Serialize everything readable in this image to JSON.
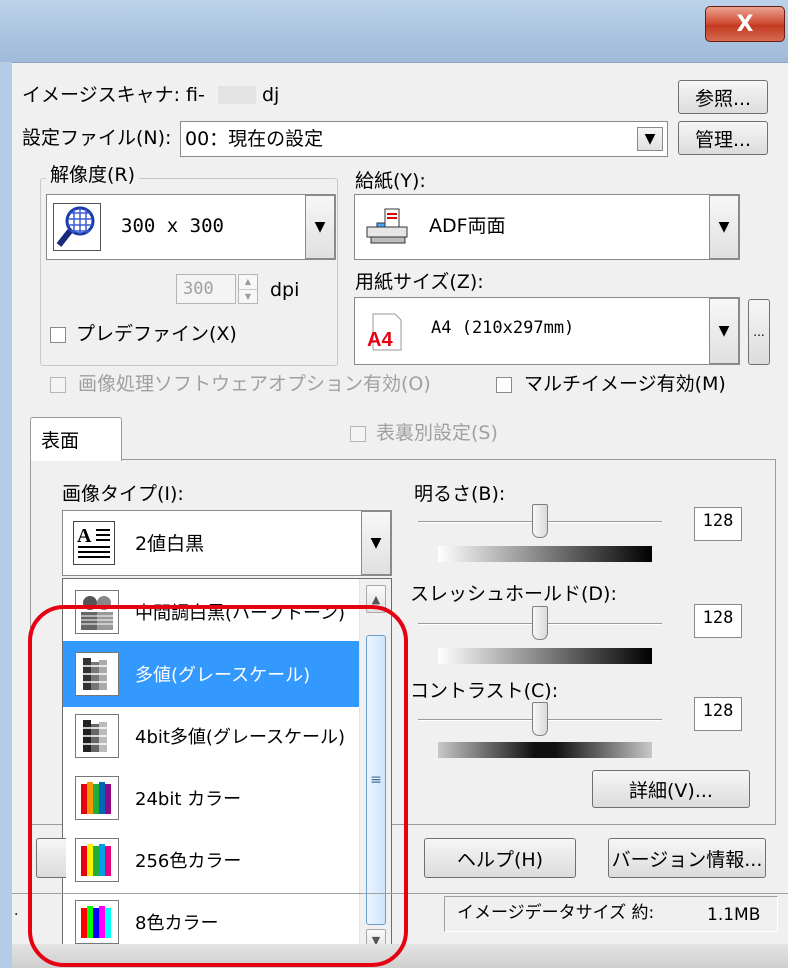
{
  "window": {
    "close_label": "X"
  },
  "scanner": {
    "label": "イメージスキャナ:",
    "model_prefix": "fi-",
    "model_suffix": "dj",
    "browse_button": "参照..."
  },
  "settings_file": {
    "label": "設定ファイル(N):",
    "value": "00：現在の設定",
    "manage_button": "管理..."
  },
  "resolution": {
    "group_label": "解像度(R)",
    "value": "300 x 300",
    "spin_value": "300",
    "unit": "dpi"
  },
  "predefine": {
    "label": "プレデファイン(X)",
    "checked": false
  },
  "paper_feed": {
    "label": "給紙(Y):",
    "value": "ADF両面"
  },
  "paper_size": {
    "label": "用紙サイズ(Z):",
    "value": "A4 (210x297mm)",
    "icon_text": "A4",
    "more_button": "..."
  },
  "image_processing": {
    "label": "画像処理ソフトウェアオプション有効(O)",
    "enabled": false
  },
  "multi_image": {
    "label": "マルチイメージ有効(M)",
    "checked": false
  },
  "tabs": {
    "front": "表面",
    "separate_settings": "表裏別設定(S)"
  },
  "image_type": {
    "label": "画像タイプ(I):",
    "selected": "2値白黒",
    "options": [
      {
        "label": "中間調白黒(ハーフトーン)",
        "icon": "halftone-icon",
        "selected": false
      },
      {
        "label": "多値(グレースケール)",
        "icon": "grayscale-icon",
        "selected": true
      },
      {
        "label": "4bit多値(グレースケール)",
        "icon": "grayscale-4bit-icon",
        "selected": false
      },
      {
        "label": "24bit カラー",
        "icon": "color-24bit-icon",
        "selected": false
      },
      {
        "label": "256色カラー",
        "icon": "color-256-icon",
        "selected": false
      },
      {
        "label": "8色カラー",
        "icon": "color-8-icon",
        "selected": false
      }
    ]
  },
  "brightness": {
    "label": "明るさ(B):",
    "value": "128",
    "level": 128,
    "max": 255
  },
  "threshold": {
    "label": "スレッシュホールド(D):",
    "value": "128",
    "level": 128,
    "max": 255
  },
  "contrast": {
    "label": "コントラスト(C):",
    "value": "128",
    "level": 128,
    "max": 255
  },
  "buttons": {
    "detail": "詳細(V)...",
    "help": "ヘルプ(H)",
    "version": "バージョン情報..."
  },
  "status": {
    "label": "イメージデータサイズ 約:",
    "value": "1.1MB"
  },
  "colors": {
    "selection": "#3399ff",
    "highlight": "#e60012",
    "close_button": "#c23a20"
  }
}
